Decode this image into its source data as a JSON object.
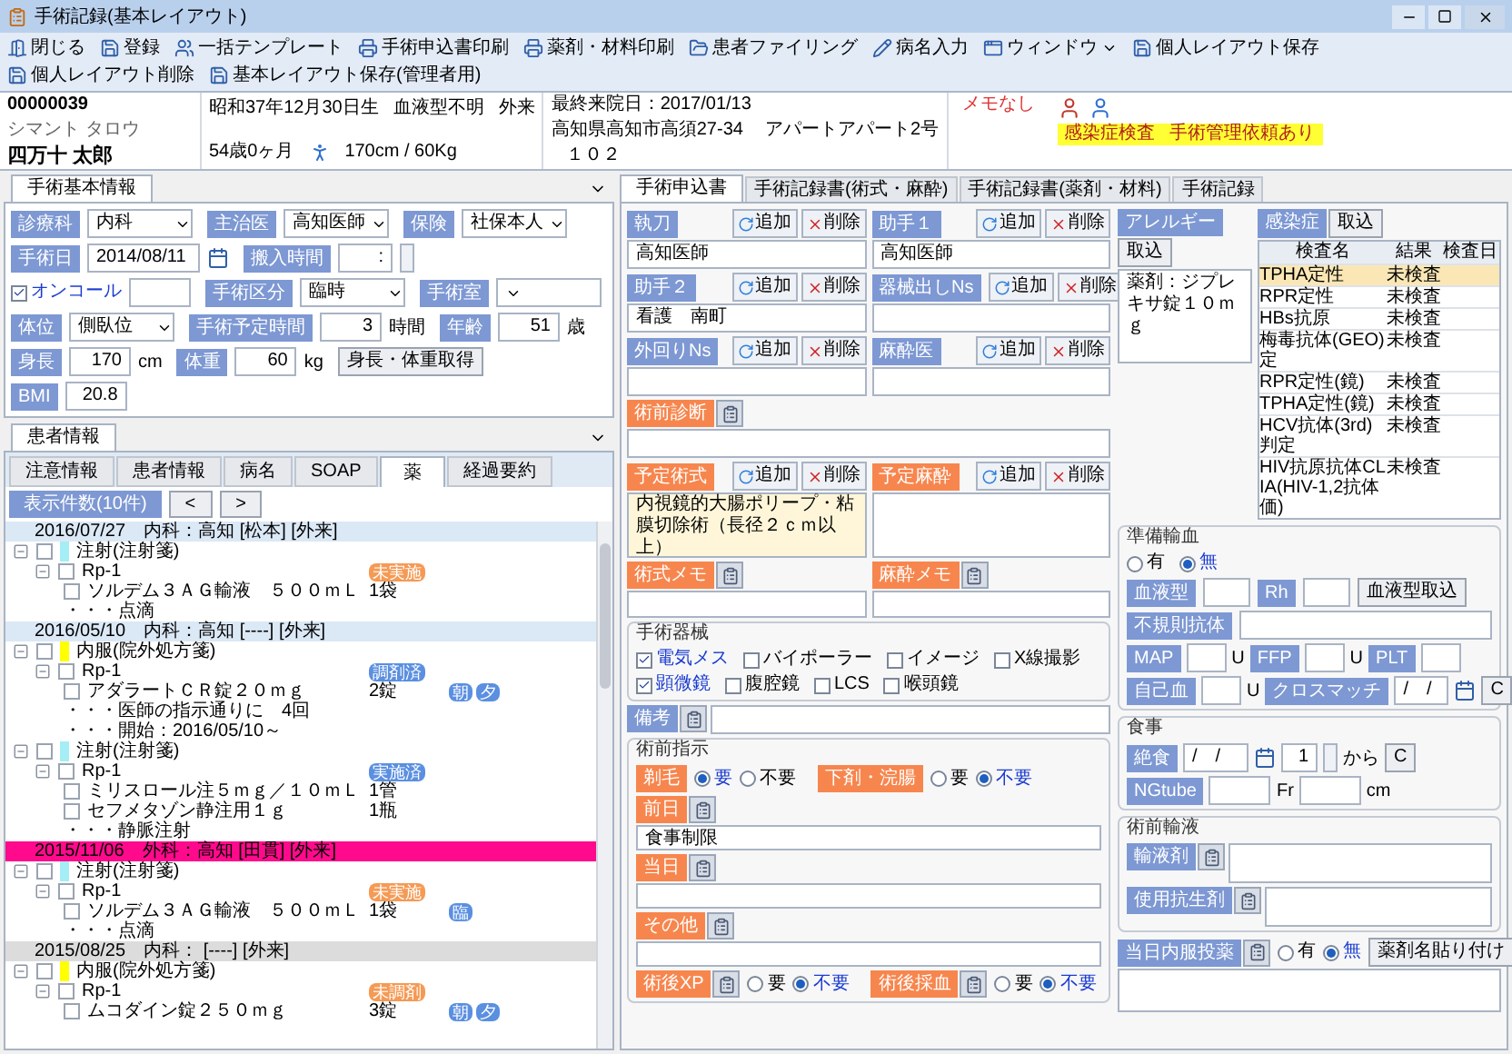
{
  "window": {
    "title": "手術記録(基本レイアウト)"
  },
  "toolbar": [
    {
      "kind": "close",
      "label": "閉じる"
    },
    {
      "kind": "save",
      "label": "登録"
    },
    {
      "kind": "template",
      "label": "一括テンプレート"
    },
    {
      "kind": "print",
      "label": "手術申込書印刷"
    },
    {
      "kind": "print",
      "label": "薬剤・材料印刷"
    },
    {
      "kind": "filing",
      "label": "患者ファイリング"
    },
    {
      "kind": "input",
      "label": "病名入力"
    },
    {
      "kind": "window",
      "label": "ウィンドウ"
    },
    {
      "kind": "save",
      "label": "個人レイアウト保存"
    },
    {
      "kind": "save",
      "label": "個人レイアウト削除"
    },
    {
      "kind": "save",
      "label": "基本レイアウト保存(管理者用)"
    }
  ],
  "patient": {
    "id": "00000039",
    "kana": "シマント タロウ",
    "name": "四万十 太郎",
    "birth": "昭和37年12月30日生",
    "blood_type": "血液型不明",
    "visit_type": "外来",
    "age": "54歳0ヶ月",
    "height_weight": "170cm / 60Kg",
    "last_visit": "最終来院日：2017/01/13",
    "address": "高知県高知市高須27-34",
    "building": "アパートアパート2号",
    "room": "１０２",
    "memo": "メモなし",
    "alerts": [
      "感染症検査",
      "手術管理依頼あり"
    ]
  },
  "basic": {
    "tab": "手術基本情報",
    "fields": [
      {
        "kind": "select",
        "label": "診療科",
        "value": "内科"
      },
      {
        "kind": "select",
        "label": "主治医",
        "value": "高知医師"
      },
      {
        "kind": "select",
        "label": "保険",
        "value": "社保本人"
      },
      {
        "kind": "date",
        "label": "手術日",
        "value": "2014/08/11"
      },
      {
        "kind": "time",
        "label": "搬入時間",
        "value": ":"
      },
      {
        "kind": "check",
        "label": "オンコール",
        "checked": true
      },
      {
        "kind": "select",
        "label": "手術区分",
        "value": "臨時"
      },
      {
        "kind": "select",
        "label": "手術室"
      },
      {
        "kind": "select",
        "label": "体位",
        "value": "側臥位"
      },
      {
        "kind": "number",
        "label": "手術予定時間",
        "value": "3",
        "unit": "時間"
      },
      {
        "kind": "number",
        "label": "年齢",
        "value": "51",
        "unit": "歳"
      },
      {
        "kind": "number",
        "label": "身長",
        "value": "170",
        "unit": "cm"
      },
      {
        "kind": "number",
        "label": "体重",
        "value": "60",
        "unit": "kg"
      },
      {
        "kind": "button",
        "label": "身長・体重取得"
      },
      {
        "kind": "number",
        "label": "BMI",
        "value": "20.8"
      }
    ]
  },
  "records": {
    "tab": "患者情報",
    "subtabs": [
      {
        "label": "注意情報",
        "selected": false
      },
      {
        "label": "患者情報",
        "selected": false
      },
      {
        "label": "病名",
        "selected": false
      },
      {
        "label": "SOAP",
        "selected": false
      },
      {
        "label": "薬",
        "selected": true
      },
      {
        "label": "経過要約",
        "selected": false
      }
    ],
    "count_button": "表示件数(10件)",
    "prev": "<",
    "next": ">",
    "entries": [
      {
        "header": "2016/07/27　内科：高知 [松本] [外来]",
        "color": "#dbe8f6",
        "children": [
          {
            "label": "注射(注射箋)",
            "color": "#a6eef5",
            "checked": false,
            "children": [
              {
                "label": "Rp-1",
                "status": "未実施",
                "color": "#f59a55",
                "checked": false,
                "children": [
                  {
                    "kind": "drug",
                    "label": "ソルデム３ＡＧ輸液　５００ｍＬ",
                    "qty": "1袋",
                    "checked": false
                  },
                  {
                    "kind": "note",
                    "label": "・・・点滴"
                  }
                ]
              }
            ]
          }
        ]
      },
      {
        "header": "2016/05/10　内科：高知 [----] [外来]",
        "color": "#dbe8f6",
        "children": [
          {
            "label": "内服(院外処方箋)",
            "color": "#ffff00",
            "checked": false,
            "children": [
              {
                "label": "Rp-1",
                "status": "調剤済",
                "color": "#5b8fe0",
                "checked": false,
                "children": [
                  {
                    "kind": "drug",
                    "label": "アダラートＣＲ錠２０ｍｇ",
                    "qty": "2錠",
                    "tags": [
                      "朝",
                      "夕"
                    ],
                    "checked": false
                  },
                  {
                    "kind": "note",
                    "label": "・・・医師の指示通りに　4回"
                  },
                  {
                    "kind": "note",
                    "label": "・・・開始：2016/05/10～"
                  }
                ]
              }
            ]
          },
          {
            "label": "注射(注射箋)",
            "color": "#a6eef5",
            "checked": false,
            "children": [
              {
                "label": "Rp-1",
                "status": "実施済",
                "color": "#5b8fe0",
                "checked": false,
                "children": [
                  {
                    "kind": "drug",
                    "label": "ミリスロール注５ｍｇ／１０ｍＬ",
                    "qty": "1管",
                    "checked": false
                  },
                  {
                    "kind": "drug",
                    "label": "セフメタゾン静注用１ｇ",
                    "qty": "1瓶",
                    "checked": false
                  },
                  {
                    "kind": "note",
                    "label": "・・・静脈注射"
                  }
                ]
              }
            ]
          }
        ]
      },
      {
        "header": "2015/11/06　外科：高知 [田貫] [外来]",
        "color": "#ff0a8c",
        "children": [
          {
            "label": "注射(注射箋)",
            "color": "#a6eef5",
            "checked": false,
            "children": [
              {
                "label": "Rp-1",
                "status": "未実施",
                "color": "#f59a55",
                "checked": false,
                "children": [
                  {
                    "kind": "drug",
                    "label": "ソルデム３ＡＧ輸液　５００ｍＬ",
                    "qty": "1袋",
                    "tags": [
                      "臨"
                    ],
                    "checked": false
                  },
                  {
                    "kind": "note",
                    "label": "・・・点滴"
                  }
                ]
              }
            ]
          }
        ]
      },
      {
        "header": "2015/08/25　内科： [----] [外来]",
        "color": "#dcdcdc",
        "children": [
          {
            "label": "内服(院外処方箋)",
            "color": "#ffff00",
            "checked": false,
            "children": [
              {
                "label": "Rp-1",
                "status": "未調剤",
                "color": "#f59a55",
                "checked": false,
                "children": [
                  {
                    "kind": "drug",
                    "label": "ムコダイン錠２５０ｍｇ",
                    "qty": "3錠",
                    "tags": [
                      "朝",
                      "夕"
                    ],
                    "checked": false
                  }
                ]
              }
            ]
          }
        ]
      }
    ]
  },
  "surgery_tabs": [
    {
      "label": "手術申込書",
      "selected": true
    },
    {
      "label": "手術記録書(術式・麻酔)",
      "selected": false
    },
    {
      "label": "手術記録書(薬剤・材料)",
      "selected": false
    },
    {
      "label": "手術記録",
      "selected": false
    }
  ],
  "staff": [
    {
      "label": "執刀",
      "add": "追加",
      "delete": "削除",
      "value": "高知医師"
    },
    {
      "label": "助手１",
      "add": "追加",
      "delete": "削除",
      "value": "高知医師"
    },
    {
      "label": "助手２",
      "add": "追加",
      "delete": "削除",
      "value": "看護　南町"
    },
    {
      "label": "器械出しNs",
      "add": "追加",
      "delete": "削除"
    },
    {
      "label": "外回りNs",
      "add": "追加",
      "delete": "削除"
    },
    {
      "label": "麻酔医",
      "add": "追加",
      "delete": "削除"
    }
  ],
  "diagnosis": {
    "label": "術前診断"
  },
  "planned": [
    {
      "label": "予定術式",
      "add": "追加",
      "delete": "削除",
      "value": "内視鏡的大腸ポリープ・粘膜切除術（長径２ｃｍ以上）"
    },
    {
      "label": "予定麻酔",
      "add": "追加",
      "delete": "削除"
    }
  ],
  "memos": [
    {
      "label": "術式メモ"
    },
    {
      "label": "麻酔メモ"
    }
  ],
  "instruments": {
    "title": "手術器械",
    "items": [
      {
        "label": "電気メス",
        "checked": true
      },
      {
        "label": "バイポーラー",
        "checked": false
      },
      {
        "label": "イメージ",
        "checked": false
      },
      {
        "label": "X線撮影",
        "checked": false
      },
      {
        "label": "顕微鏡",
        "checked": true
      },
      {
        "label": "腹腔鏡",
        "checked": false
      },
      {
        "label": "LCS",
        "checked": false
      },
      {
        "label": "喉頭鏡",
        "checked": false
      }
    ]
  },
  "remarks": {
    "label": "備考"
  },
  "preop": {
    "title": "術前指示",
    "choices": [
      {
        "label": "剃毛",
        "options": [
          {
            "label": "要",
            "selected": true
          },
          {
            "label": "不要",
            "selected": false
          }
        ]
      },
      {
        "label": "下剤・浣腸",
        "options": [
          {
            "label": "要",
            "selected": false
          },
          {
            "label": "不要",
            "selected": true
          }
        ]
      }
    ],
    "notes": [
      {
        "label": "前日",
        "value": "食事制限"
      },
      {
        "label": "当日"
      },
      {
        "label": "その他"
      }
    ],
    "post": [
      {
        "label": "術後XP",
        "options": [
          {
            "label": "要",
            "selected": false
          },
          {
            "label": "不要",
            "selected": true
          }
        ]
      },
      {
        "label": "術後採血",
        "options": [
          {
            "label": "要",
            "selected": false
          },
          {
            "label": "不要",
            "selected": true
          }
        ]
      }
    ]
  },
  "allergy": {
    "label": "アレルギー",
    "button": "取込",
    "value": "薬剤：ジプレキサ錠１０ｍｇ"
  },
  "infection": {
    "label": "感染症",
    "button": "取込",
    "columns": [
      "検査名",
      "結果",
      "検査日"
    ],
    "rows": [
      {
        "name": "TPHA定性",
        "result": "未検査",
        "selected": true
      },
      {
        "name": "RPR定性",
        "result": "未検査",
        "selected": false
      },
      {
        "name": "HBs抗原",
        "result": "未検査",
        "selected": false
      },
      {
        "name": "梅毒抗体(GEO)定",
        "result": "未検査",
        "selected": false
      },
      {
        "name": "RPR定性(鏡)",
        "result": "未検査",
        "selected": false
      },
      {
        "name": "TPHA定性(鏡)",
        "result": "未検査",
        "selected": false
      },
      {
        "name": "HCV抗体(3rd)判定",
        "result": "未検査",
        "selected": false
      },
      {
        "name": "HIV抗原抗体CLIA(HIV-1,2抗体価)",
        "result": "未検査",
        "selected": false
      }
    ]
  },
  "transfusion": {
    "title": "準備輸血",
    "options": [
      {
        "label": "有",
        "selected": false
      },
      {
        "label": "無",
        "selected": true
      }
    ],
    "blood_type": "血液型",
    "rh": "Rh",
    "import": "血液型取込",
    "antibody": "不規則抗体",
    "products": [
      {
        "label": "MAP",
        "unit": "U"
      },
      {
        "label": "FFP",
        "unit": "U"
      },
      {
        "label": "PLT"
      }
    ],
    "autologous": {
      "label": "自己血",
      "unit": "U"
    },
    "crossmatch": {
      "label": "クロスマッチ",
      "value": "/　/",
      "clear": "C"
    }
  },
  "meal": {
    "title": "食事",
    "fast": {
      "label": "絶食",
      "date": "/　/",
      "days": "1",
      "from": "から",
      "clear": "C"
    },
    "ngtube": {
      "label": "NGtube",
      "unit": "Fr",
      "unit2": "cm"
    }
  },
  "infusion": {
    "title": "術前輸液",
    "fields": [
      {
        "label": "輸液剤"
      },
      {
        "label": "使用抗生剤"
      }
    ]
  },
  "oral": {
    "label": "当日内服投薬",
    "options": [
      {
        "label": "有",
        "selected": false
      },
      {
        "label": "無",
        "selected": true
      }
    ],
    "button": "薬剤名貼り付け"
  }
}
